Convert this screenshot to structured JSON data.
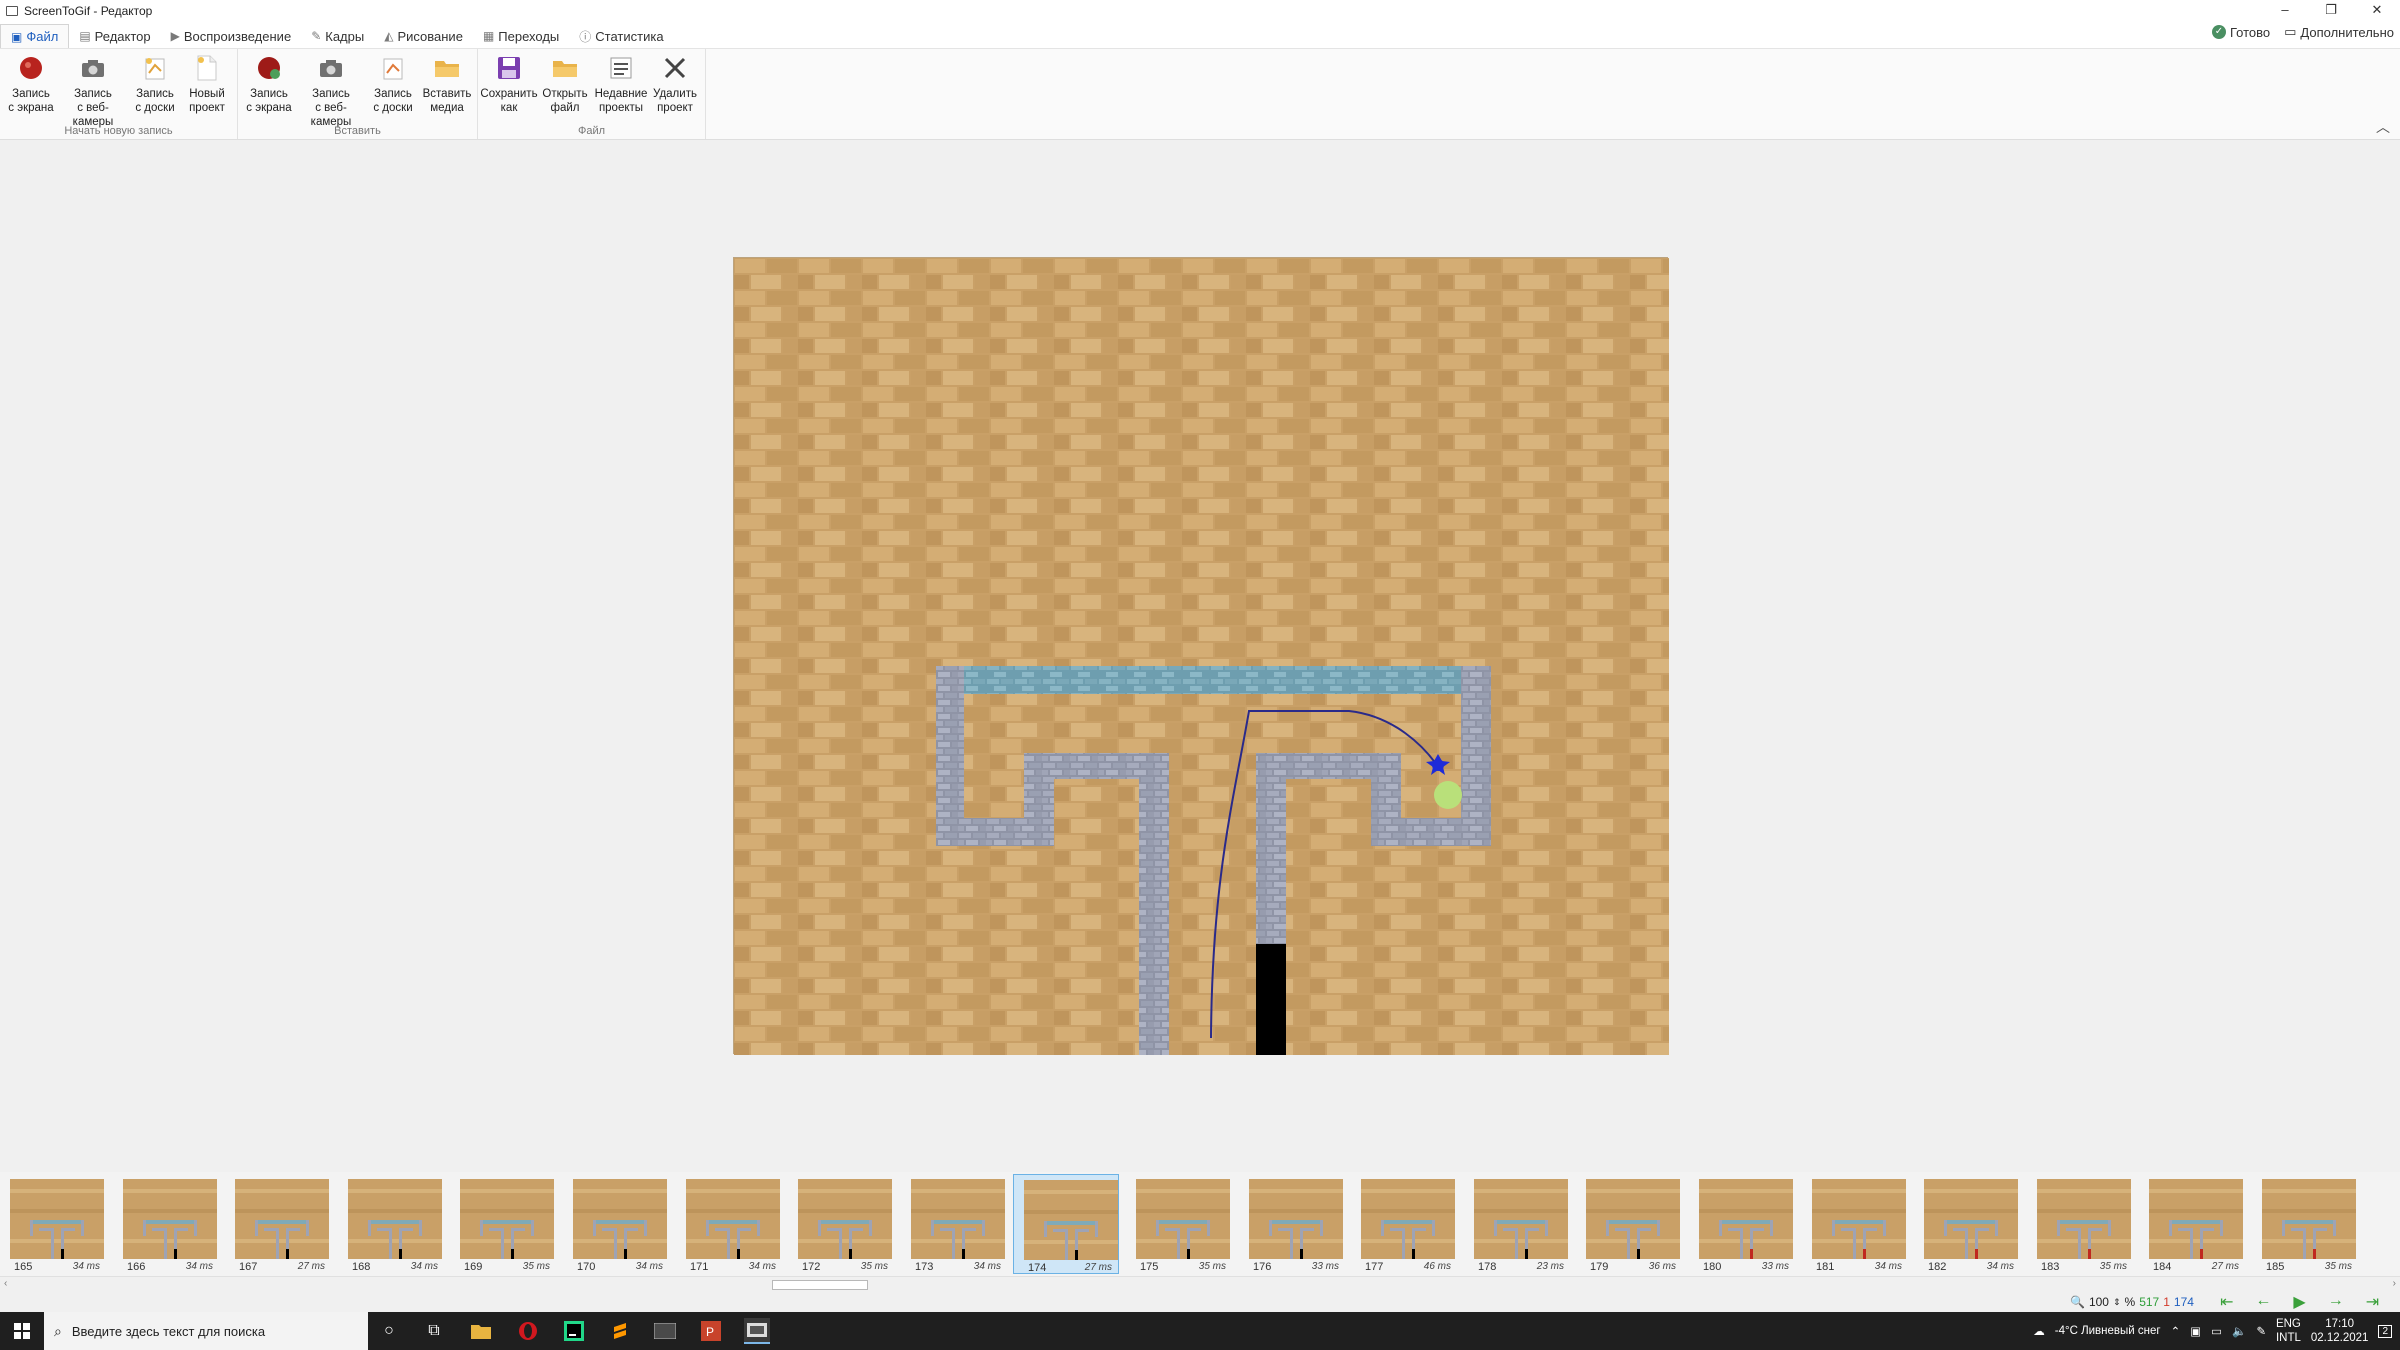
{
  "window": {
    "title": "ScreenToGif - Редактор",
    "minimize": "–",
    "restore": "❐",
    "close": "✕"
  },
  "tabs": [
    {
      "label": "Файл",
      "icon": "save-icon"
    },
    {
      "label": "Редактор",
      "icon": "editor-icon"
    },
    {
      "label": "Воспроизведение",
      "icon": "play-icon"
    },
    {
      "label": "Кадры",
      "icon": "frames-icon"
    },
    {
      "label": "Рисование",
      "icon": "draw-icon"
    },
    {
      "label": "Переходы",
      "icon": "transitions-icon"
    },
    {
      "label": "Статистика",
      "icon": "info-icon"
    }
  ],
  "tab_right": {
    "status": "Готово",
    "more": "Дополнительно"
  },
  "ribbon": {
    "groups": [
      {
        "label": "Начать новую запись",
        "buttons": [
          {
            "line1": "Запись",
            "line2": "с экрана",
            "icon": "record-icon"
          },
          {
            "line1": "Запись",
            "line2": "с веб-камеры",
            "icon": "camera-icon"
          },
          {
            "line1": "Запись",
            "line2": "с доски",
            "icon": "board-icon"
          },
          {
            "line1": "Новый",
            "line2": "проект",
            "icon": "new-file-icon"
          }
        ]
      },
      {
        "label": "Вставить",
        "buttons": [
          {
            "line1": "Запись",
            "line2": "с экрана",
            "icon": "record-icon"
          },
          {
            "line1": "Запись",
            "line2": "с веб-камеры",
            "icon": "camera-icon"
          },
          {
            "line1": "Запись",
            "line2": "с доски",
            "icon": "board-icon"
          },
          {
            "line1": "Вставить",
            "line2": "медиа",
            "icon": "folder-icon"
          }
        ]
      },
      {
        "label": "Файл",
        "buttons": [
          {
            "line1": "Сохранить",
            "line2": "как",
            "icon": "save-icon"
          },
          {
            "line1": "Открыть",
            "line2": "файл",
            "icon": "folder-icon"
          },
          {
            "line1": "Недавние",
            "line2": "проекты",
            "icon": "recent-icon"
          },
          {
            "line1": "Удалить",
            "line2": "проект",
            "icon": "delete-icon"
          }
        ]
      }
    ]
  },
  "frames": [
    {
      "num": "165",
      "ms": "34 ms"
    },
    {
      "num": "166",
      "ms": "34 ms"
    },
    {
      "num": "167",
      "ms": "27 ms"
    },
    {
      "num": "168",
      "ms": "34 ms"
    },
    {
      "num": "169",
      "ms": "35 ms"
    },
    {
      "num": "170",
      "ms": "34 ms"
    },
    {
      "num": "171",
      "ms": "34 ms"
    },
    {
      "num": "172",
      "ms": "35 ms"
    },
    {
      "num": "173",
      "ms": "34 ms"
    },
    {
      "num": "174",
      "ms": "27 ms",
      "selected": true
    },
    {
      "num": "175",
      "ms": "35 ms"
    },
    {
      "num": "176",
      "ms": "33 ms"
    },
    {
      "num": "177",
      "ms": "46 ms"
    },
    {
      "num": "178",
      "ms": "23 ms"
    },
    {
      "num": "179",
      "ms": "36 ms"
    },
    {
      "num": "180",
      "ms": "33 ms"
    },
    {
      "num": "181",
      "ms": "34 ms"
    },
    {
      "num": "182",
      "ms": "34 ms"
    },
    {
      "num": "183",
      "ms": "35 ms"
    },
    {
      "num": "184",
      "ms": "27 ms"
    },
    {
      "num": "185",
      "ms": "35 ms"
    }
  ],
  "status": {
    "zoom": "100",
    "percent": "%",
    "total": "517",
    "selected": "1",
    "current": "174"
  },
  "taskbar": {
    "search_placeholder": "Введите здесь текст для поиска",
    "weather": "-4°C  Ливневый снег",
    "lang1": "ENG",
    "lang2": "INTL",
    "time": "17:10",
    "date": "02.12.2021",
    "notifications": "2"
  },
  "colors": {
    "accent": "#1f5fbf",
    "selected_frame": "#cfe6f7",
    "brick": "#c8a06a",
    "wall": "#9ea3b5",
    "water": "#7faab8"
  }
}
